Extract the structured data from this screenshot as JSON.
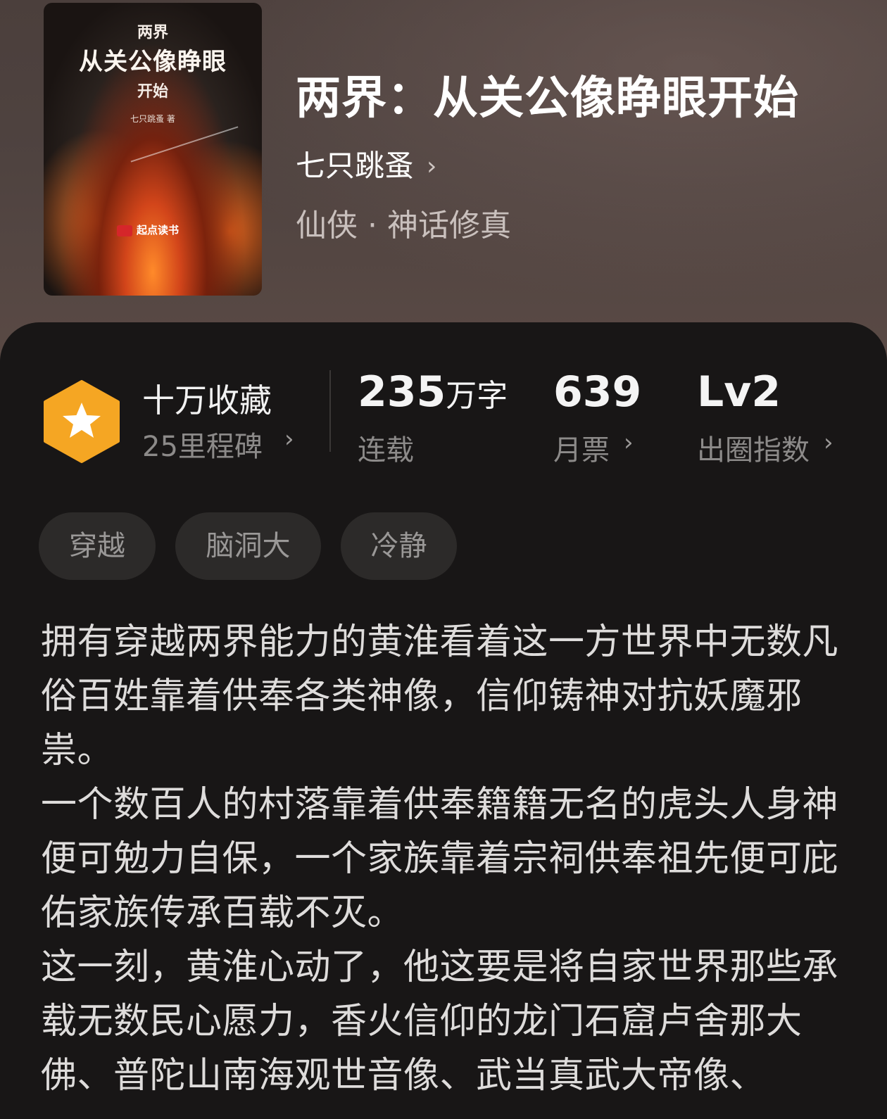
{
  "book": {
    "title": "两界：从关公像睁眼开始",
    "author": "七只跳蚤",
    "author_chevron": "›",
    "genre": "仙侠 · 神话修真"
  },
  "cover": {
    "line1": "两界",
    "line2": "从关公像睁眼",
    "line3": "开始",
    "author": "七只跳蚤 著",
    "brand": "起点读书",
    "brand_mark": "起点"
  },
  "stats": {
    "collection_title": "十万收藏",
    "collection_sub": "25里程碑",
    "collection_chevron": "›",
    "words_number": "235",
    "words_unit": "万字",
    "words_sub": "连载",
    "votes_number": "639",
    "votes_sub": "月票",
    "votes_chevron": "›",
    "index_number": "Lv2",
    "index_sub": "出圈指数",
    "index_chevron": "›"
  },
  "tags": [
    "穿越",
    "脑洞大",
    "冷静"
  ],
  "description": {
    "paragraphs": [
      "拥有穿越两界能力的黄淮看着这一方世界中无数凡俗百姓靠着供奉各类神像，信仰铸神对抗妖魔邪祟。",
      "一个数百人的村落靠着供奉籍籍无名的虎头人身神便可勉力自保，一个家族靠着宗祠供奉祖先便可庇佑家族传承百载不灭。",
      "这一刻，黄淮心动了，他这要是将自家世界那些承载无数民心愿力，香火信仰的龙门石窟卢舍那大佛、普陀山南海观世音像、武当真武大帝像、"
    ]
  },
  "colors": {
    "badge_orange": "#f5a623",
    "panel_bg": "#181616",
    "tag_bg": "#2c2a29"
  }
}
